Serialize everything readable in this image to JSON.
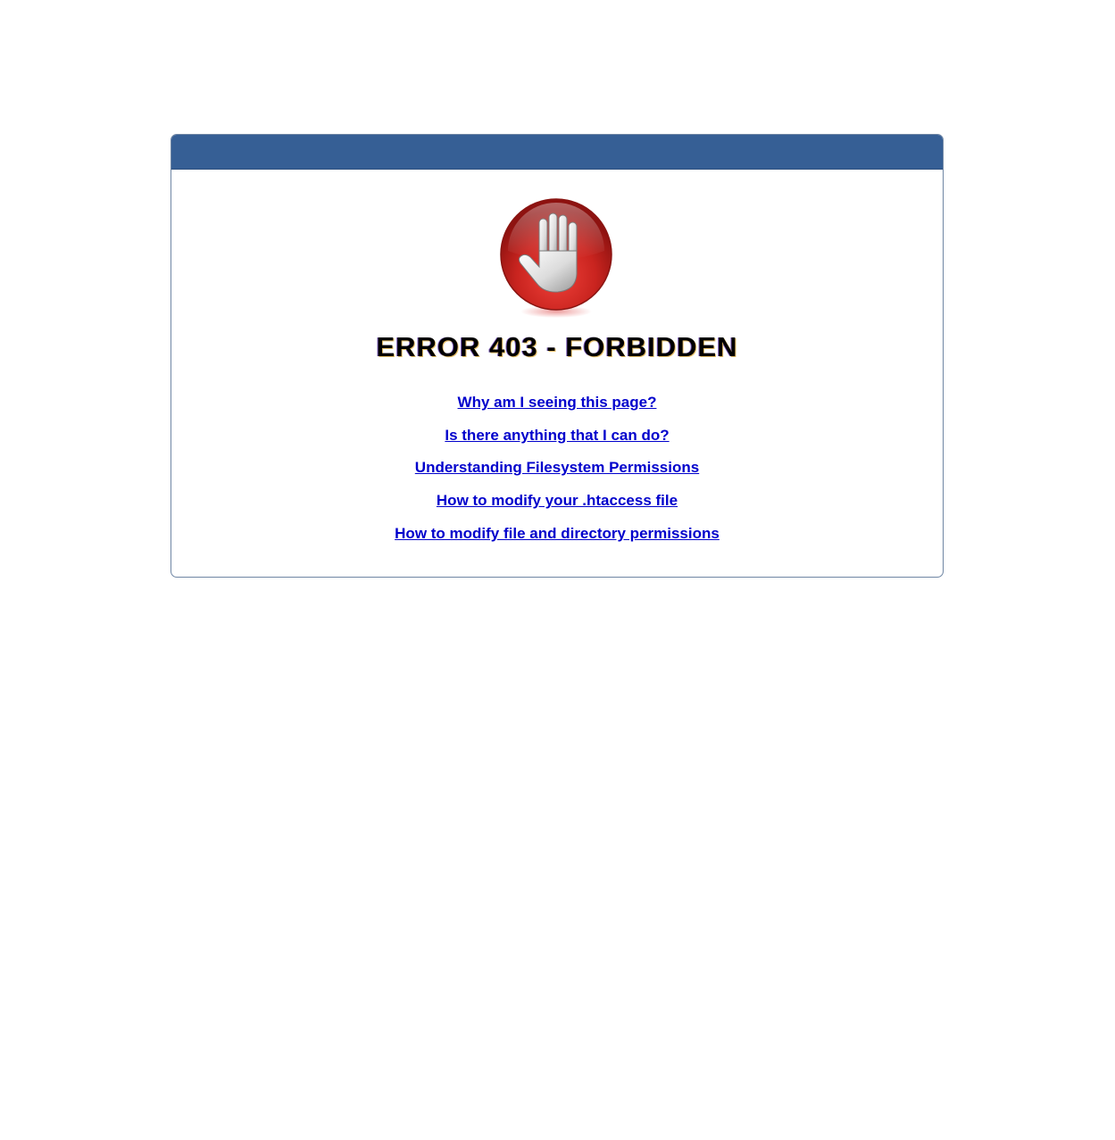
{
  "error": {
    "title": "ERROR 403 - FORBIDDEN",
    "icon": "stop-hand-icon"
  },
  "links": [
    {
      "label": "Why am I seeing this page?"
    },
    {
      "label": "Is there anything that I can do?"
    },
    {
      "label": "Understanding Filesystem Permissions"
    },
    {
      "label": "How to modify your .htaccess file"
    },
    {
      "label": "How to modify file and directory permissions"
    }
  ],
  "colors": {
    "header_bar": "#365f95",
    "link": "#0000cc",
    "icon_red": "#c0231f"
  }
}
